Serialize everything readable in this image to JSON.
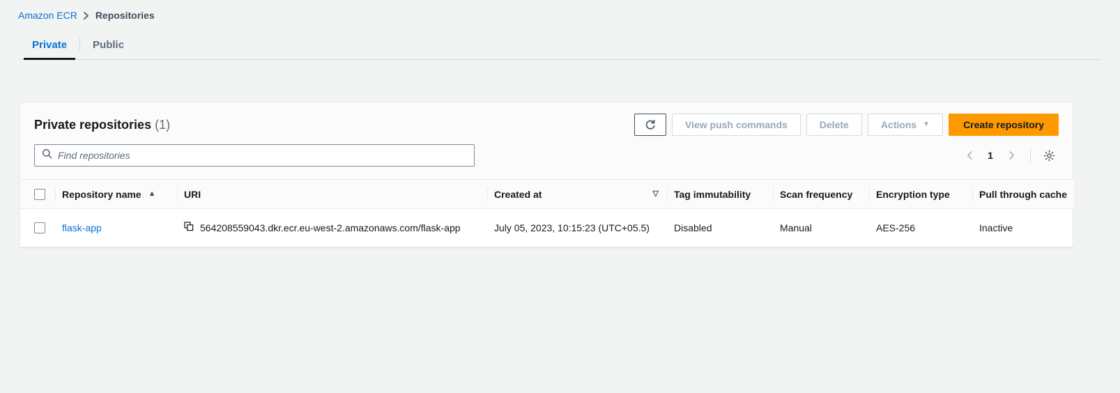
{
  "breadcrumb": {
    "root": "Amazon ECR",
    "separator_icon": "chevron-right-icon",
    "current": "Repositories"
  },
  "tabs": [
    {
      "label": "Private",
      "active": true
    },
    {
      "label": "Public",
      "active": false
    }
  ],
  "panel": {
    "title": "Private repositories",
    "count": "(1)",
    "buttons": {
      "refresh_icon": "refresh-icon",
      "view_push_commands": "View push commands",
      "delete": "Delete",
      "actions": "Actions",
      "actions_caret_icon": "chevron-down-icon",
      "create_repository": "Create repository"
    },
    "search": {
      "icon": "search-icon",
      "placeholder": "Find repositories",
      "value": ""
    },
    "pagination": {
      "prev_icon": "chevron-left-icon",
      "page": "1",
      "next_icon": "chevron-right-icon",
      "settings_icon": "gear-icon"
    }
  },
  "table": {
    "columns": [
      {
        "label": "Repository name",
        "sort": "asc"
      },
      {
        "label": "URI",
        "sort": null
      },
      {
        "label": "Created at",
        "sort": "desc"
      },
      {
        "label": "Tag immutability",
        "sort": null
      },
      {
        "label": "Scan frequency",
        "sort": null
      },
      {
        "label": "Encryption type",
        "sort": null
      },
      {
        "label": "Pull through cache",
        "sort": null
      }
    ],
    "sort_asc_icon": "▲",
    "sort_desc_icon": "▽",
    "rows": [
      {
        "repository_name": "flask-app",
        "uri_copy_icon": "copy-icon",
        "uri": "564208559043.dkr.ecr.eu-west-2.amazonaws.com/flask-app",
        "created_at": "July 05, 2023, 10:15:23 (UTC+05.5)",
        "tag_immutability": "Disabled",
        "scan_frequency": "Manual",
        "encryption_type": "AES-256",
        "pull_through_cache": "Inactive"
      }
    ]
  },
  "colors": {
    "link": "#0972d3",
    "primary_button": "#ff9900",
    "page_background": "#f2f3f3",
    "panel_background": "#ffffff"
  }
}
